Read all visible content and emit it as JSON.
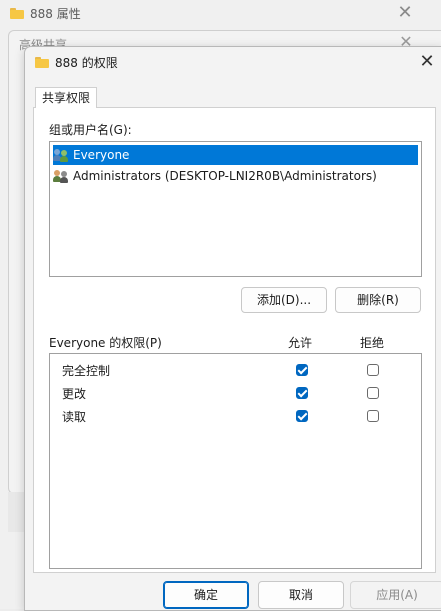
{
  "back_window": {
    "title": "888 属性",
    "close": "✕"
  },
  "mid_window": {
    "title": "高级共享",
    "close": "✕"
  },
  "dialog": {
    "title": "888 的权限",
    "close": "✕",
    "tab": "共享权限",
    "users_label": "组或用户名(G):",
    "users": [
      {
        "name": "Everyone",
        "icon": "users-icon",
        "selected": true
      },
      {
        "name": "Administrators (DESKTOP-LNI2R0B\\Administrators)",
        "icon": "admin-group-icon",
        "selected": false
      }
    ],
    "add_button": "添加(D)...",
    "remove_button": "删除(R)",
    "permissions_label": "Everyone 的权限(P)",
    "allow_header": "允许",
    "deny_header": "拒绝",
    "permissions": [
      {
        "name": "完全控制",
        "allow": true,
        "deny": false
      },
      {
        "name": "更改",
        "allow": true,
        "deny": false
      },
      {
        "name": "读取",
        "allow": true,
        "deny": false
      }
    ],
    "ok_button": "确定",
    "cancel_button": "取消",
    "apply_button": "应用(A)"
  },
  "colors": {
    "accent": "#0067c0",
    "selection": "#0078d7"
  }
}
